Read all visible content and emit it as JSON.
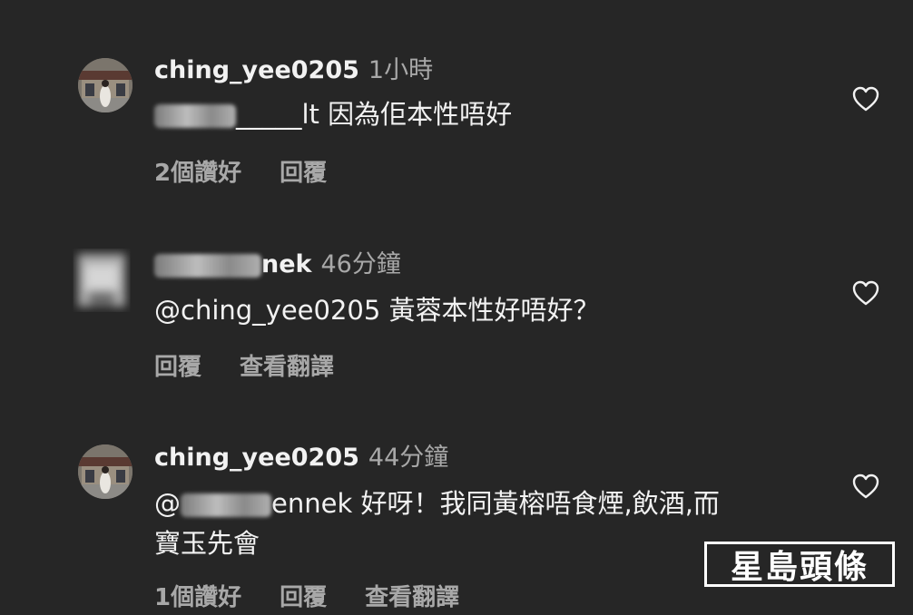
{
  "comments": [
    {
      "username": "ching_yee0205",
      "time": "1小時",
      "mention_visible": "_____",
      "text": "lt 因為佢本性唔好",
      "likes": "2個讚好",
      "reply": "回覆"
    },
    {
      "username_visible": "nek",
      "time": "46分鐘",
      "text": "@ching_yee0205 黃蓉本性好唔好？",
      "reply": "回覆",
      "translate": "查看翻譯"
    },
    {
      "username": "ching_yee0205",
      "time": "44分鐘",
      "mention_prefix": "@",
      "mention_visible": "ennek",
      "text_line1": "好呀！我同黃榕唔食煙,飲酒,而",
      "text_line2": "寶玉先會",
      "likes": "1個讚好",
      "reply": "回覆",
      "translate": "查看翻譯"
    }
  ],
  "watermark": "星島頭條",
  "colors": {
    "background": "#262626",
    "primary_text": "#f2f2f2",
    "secondary_text": "#a8a8a8"
  },
  "icons": [
    "heart-icon",
    "avatar"
  ]
}
